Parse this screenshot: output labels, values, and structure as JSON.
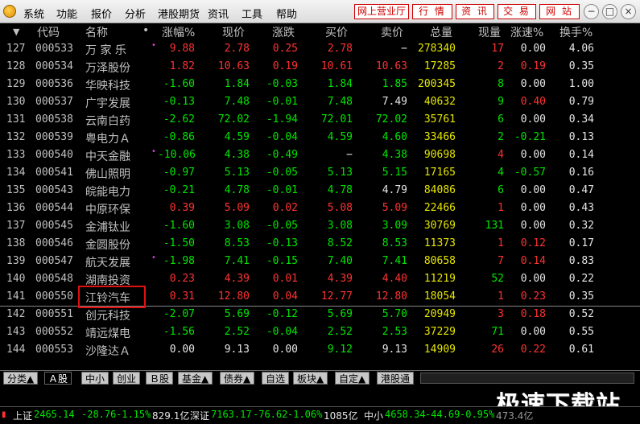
{
  "menu": [
    "系统",
    "功能",
    "报价",
    "分析",
    "港股期货",
    "资讯",
    "工具",
    "帮助"
  ],
  "top_buttons": [
    "网上营业厅",
    "行 情",
    "资 讯",
    "交 易",
    "网 站"
  ],
  "window_buttons": [
    "−",
    "□",
    "×"
  ],
  "columns": [
    "▼",
    "代码",
    "名称",
    "•",
    "涨幅%",
    "现价",
    "涨跌",
    "买价",
    "卖价",
    "总量",
    "现量",
    "涨速%",
    "换手%"
  ],
  "rows": [
    {
      "idx": "127",
      "code": "000533",
      "name": "万 家 乐",
      "dot": "•",
      "pct": "9.88",
      "price": "2.78",
      "chg": "0.25",
      "bid": "2.78",
      "ask": "−",
      "vol": "278340",
      "cur": "17",
      "speed": "0.00",
      "turn": "4.06",
      "d": "up",
      "cd": "up",
      "sd": "wh"
    },
    {
      "idx": "128",
      "code": "000534",
      "name": "万泽股份",
      "dot": "",
      "pct": "1.82",
      "price": "10.63",
      "chg": "0.19",
      "bid": "10.61",
      "ask": "10.63",
      "vol": "17285",
      "cur": "2",
      "speed": "0.19",
      "turn": "0.35",
      "d": "up",
      "cd": "up",
      "sd": "up"
    },
    {
      "idx": "129",
      "code": "000536",
      "name": "华映科技",
      "dot": "",
      "pct": "-1.60",
      "price": "1.84",
      "chg": "-0.03",
      "bid": "1.84",
      "ask": "1.85",
      "vol": "200345",
      "cur": "8",
      "speed": "0.00",
      "turn": "1.00",
      "d": "dn",
      "cd": "dn",
      "sd": "wh"
    },
    {
      "idx": "130",
      "code": "000537",
      "name": "广宇发展",
      "dot": "",
      "pct": "-0.13",
      "price": "7.48",
      "chg": "-0.01",
      "bid": "7.48",
      "ask": "7.49",
      "vol": "40632",
      "cur": "9",
      "speed": "0.40",
      "turn": "0.79",
      "d": "dn",
      "cd": "dn",
      "sd": "up",
      "ad": "wh"
    },
    {
      "idx": "131",
      "code": "000538",
      "name": "云南白药",
      "dot": "",
      "pct": "-2.62",
      "price": "72.02",
      "chg": "-1.94",
      "bid": "72.01",
      "ask": "72.02",
      "vol": "35761",
      "cur": "6",
      "speed": "0.00",
      "turn": "0.34",
      "d": "dn",
      "cd": "dn",
      "sd": "wh"
    },
    {
      "idx": "132",
      "code": "000539",
      "name": "粤电力Ａ",
      "dot": "",
      "pct": "-0.86",
      "price": "4.59",
      "chg": "-0.04",
      "bid": "4.59",
      "ask": "4.60",
      "vol": "33466",
      "cur": "2",
      "speed": "-0.21",
      "turn": "0.13",
      "d": "dn",
      "cd": "dn",
      "sd": "dn"
    },
    {
      "idx": "133",
      "code": "000540",
      "name": "中天金融",
      "dot": "•",
      "pct": "-10.06",
      "price": "4.38",
      "chg": "-0.49",
      "bid": "−",
      "ask": "4.38",
      "vol": "90698",
      "cur": "4",
      "speed": "0.00",
      "turn": "0.14",
      "d": "dn",
      "cd": "up",
      "sd": "wh"
    },
    {
      "idx": "134",
      "code": "000541",
      "name": "佛山照明",
      "dot": "",
      "pct": "-0.97",
      "price": "5.13",
      "chg": "-0.05",
      "bid": "5.13",
      "ask": "5.15",
      "vol": "17165",
      "cur": "4",
      "speed": "-0.57",
      "turn": "0.16",
      "d": "dn",
      "cd": "dn",
      "sd": "dn"
    },
    {
      "idx": "135",
      "code": "000543",
      "name": "皖能电力",
      "dot": "",
      "pct": "-0.21",
      "price": "4.78",
      "chg": "-0.01",
      "bid": "4.78",
      "ask": "4.79",
      "vol": "84086",
      "cur": "6",
      "speed": "0.00",
      "turn": "0.47",
      "d": "dn",
      "cd": "dn",
      "sd": "wh",
      "ad": "wh"
    },
    {
      "idx": "136",
      "code": "000544",
      "name": "中原环保",
      "dot": "",
      "pct": "0.39",
      "price": "5.09",
      "chg": "0.02",
      "bid": "5.08",
      "ask": "5.09",
      "vol": "22466",
      "cur": "1",
      "speed": "0.00",
      "turn": "0.43",
      "d": "up",
      "cd": "up",
      "sd": "wh"
    },
    {
      "idx": "137",
      "code": "000545",
      "name": "金浦钛业",
      "dot": "",
      "pct": "-1.60",
      "price": "3.08",
      "chg": "-0.05",
      "bid": "3.08",
      "ask": "3.09",
      "vol": "30769",
      "cur": "131",
      "speed": "0.00",
      "turn": "0.32",
      "d": "dn",
      "cd": "dn",
      "sd": "wh"
    },
    {
      "idx": "138",
      "code": "000546",
      "name": "金圆股份",
      "dot": "",
      "pct": "-1.50",
      "price": "8.53",
      "chg": "-0.13",
      "bid": "8.52",
      "ask": "8.53",
      "vol": "11373",
      "cur": "1",
      "speed": "0.12",
      "turn": "0.17",
      "d": "dn",
      "cd": "up",
      "sd": "up"
    },
    {
      "idx": "139",
      "code": "000547",
      "name": "航天发展",
      "dot": "•",
      "pct": "-1.98",
      "price": "7.41",
      "chg": "-0.15",
      "bid": "7.40",
      "ask": "7.41",
      "vol": "80658",
      "cur": "7",
      "speed": "0.14",
      "turn": "0.83",
      "d": "dn",
      "cd": "up",
      "sd": "up"
    },
    {
      "idx": "140",
      "code": "000548",
      "name": "湖南投资",
      "dot": "",
      "pct": "0.23",
      "price": "4.39",
      "chg": "0.01",
      "bid": "4.39",
      "ask": "4.40",
      "vol": "11219",
      "cur": "52",
      "speed": "0.00",
      "turn": "0.22",
      "d": "up",
      "cd": "dn",
      "sd": "wh"
    },
    {
      "idx": "141",
      "code": "000550",
      "name": "江铃汽车",
      "dot": "",
      "pct": "0.31",
      "price": "12.80",
      "chg": "0.04",
      "bid": "12.77",
      "ask": "12.80",
      "vol": "18054",
      "cur": "1",
      "speed": "0.23",
      "turn": "0.35",
      "d": "up",
      "cd": "up",
      "sd": "up"
    },
    {
      "idx": "142",
      "code": "000551",
      "name": "创元科技",
      "dot": "",
      "pct": "-2.07",
      "price": "5.69",
      "chg": "-0.12",
      "bid": "5.69",
      "ask": "5.70",
      "vol": "20949",
      "cur": "3",
      "speed": "0.18",
      "turn": "0.52",
      "d": "dn",
      "cd": "up",
      "sd": "up"
    },
    {
      "idx": "143",
      "code": "000552",
      "name": "靖远煤电",
      "dot": "",
      "pct": "-1.56",
      "price": "2.52",
      "chg": "-0.04",
      "bid": "2.52",
      "ask": "2.53",
      "vol": "37229",
      "cur": "71",
      "speed": "0.00",
      "turn": "0.55",
      "d": "dn",
      "cd": "dn",
      "sd": "wh"
    },
    {
      "idx": "144",
      "code": "000553",
      "name": "沙隆达Ａ",
      "dot": "",
      "pct": "0.00",
      "price": "9.13",
      "chg": "0.00",
      "bid": "9.12",
      "ask": "9.13",
      "vol": "14909",
      "cur": "26",
      "speed": "0.22",
      "turn": "0.61",
      "d": "wh",
      "cd": "up",
      "sd": "up",
      "ad": "wh",
      "bd": "dn"
    }
  ],
  "tabs": [
    "分类▲",
    "Ａ股",
    "中小",
    "创业",
    "Ｂ股",
    "基金▲",
    "债券▲",
    "自选",
    "板块▲",
    "自定▲",
    "港股通"
  ],
  "active_tab": "Ａ股",
  "status": {
    "sh_label": "上证",
    "sh_val": "2465.14",
    "sh_chg": "-28.76",
    "sh_pct": "-1.15%",
    "sh_amt": "829.1亿",
    "sz_label": "深证",
    "sz_val": "7163.17",
    "sz_chg": "-76.62",
    "sz_pct": "-1.06%",
    "sz_amt": "1085亿",
    "zx_label": "中小",
    "zx_val": "4658.34",
    "zx_chg": "-44.69",
    "zx_pct": "-0.95%",
    "zx_amt": "473.4亿"
  },
  "watermark": "极速下载站",
  "colors": {
    "up": "#ff3232",
    "down": "#00e600",
    "highlight": "#e01010"
  }
}
